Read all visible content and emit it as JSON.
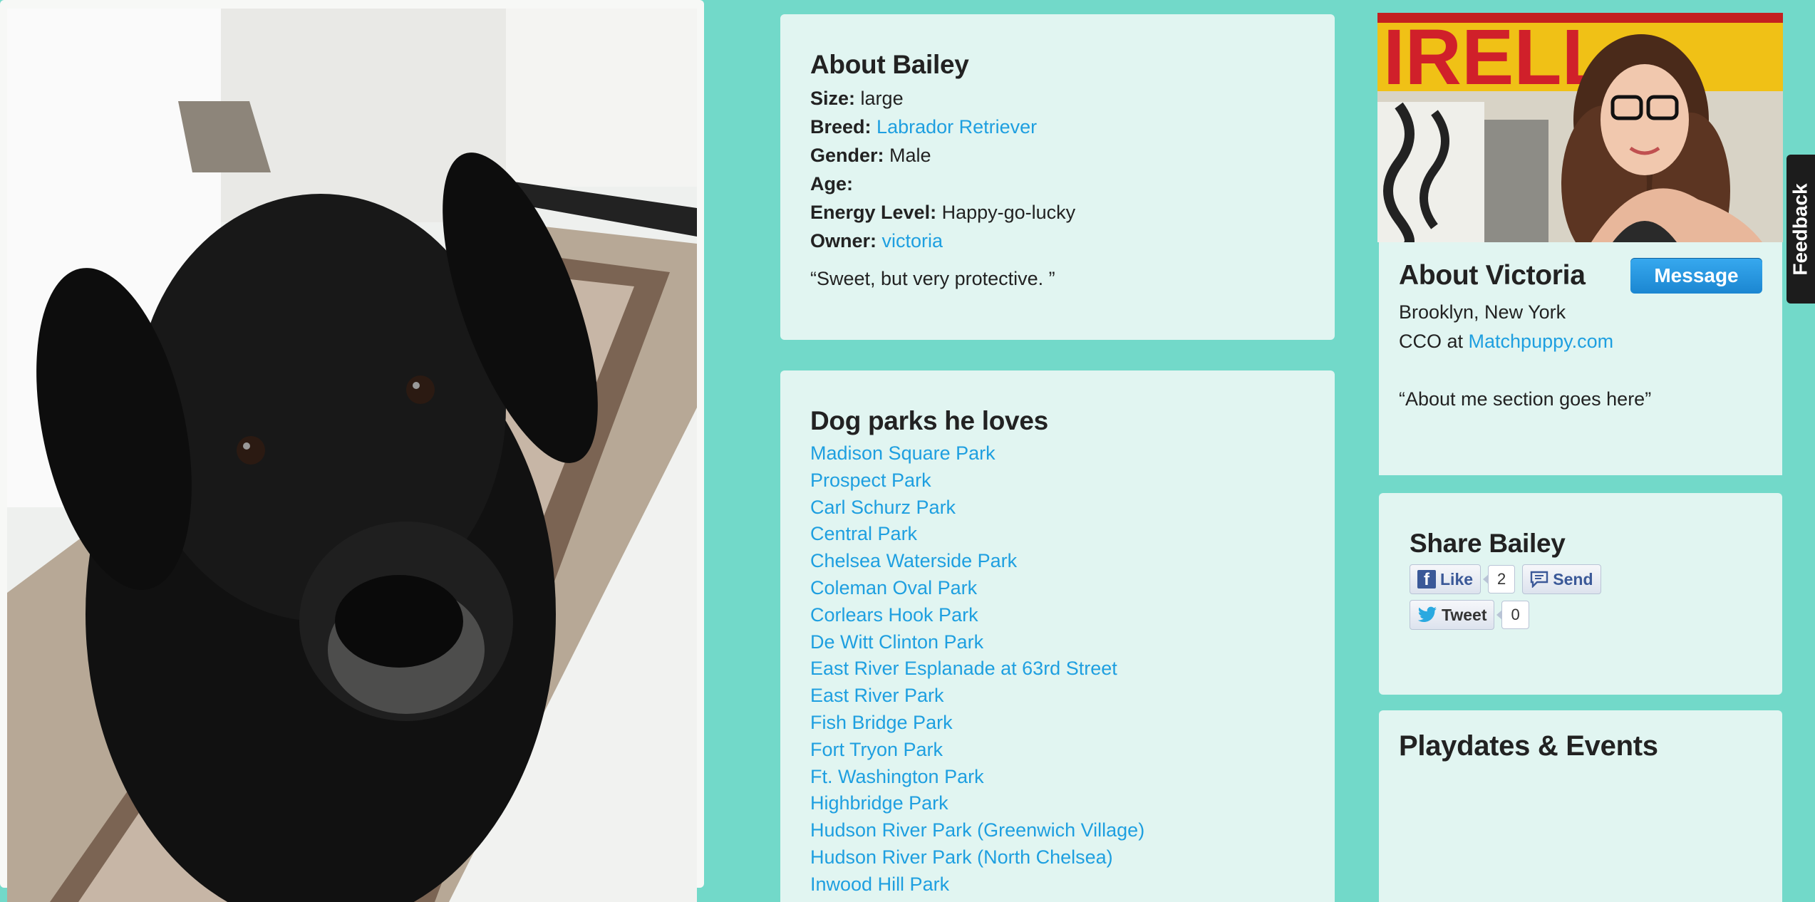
{
  "dog": {
    "heading": "About Bailey",
    "facts": [
      {
        "label": "Size:",
        "value": "large",
        "link": false
      },
      {
        "label": "Breed:",
        "value": "Labrador Retriever",
        "link": true
      },
      {
        "label": "Gender:",
        "value": "Male",
        "link": false
      },
      {
        "label": "Age:",
        "value": "",
        "link": false
      },
      {
        "label": "Energy Level:",
        "value": "Happy-go-lucky",
        "link": false
      },
      {
        "label": "Owner:",
        "value": "victoria",
        "link": true
      }
    ],
    "quote": "“Sweet, but very protective. ”"
  },
  "parks": {
    "heading": "Dog parks he loves",
    "items": [
      "Madison Square Park",
      "Prospect Park",
      "Carl Schurz Park",
      "Central Park",
      "Chelsea Waterside Park",
      "Coleman Oval Park",
      "Corlears Hook Park",
      "De Witt Clinton Park",
      "East River Esplanade at 63rd Street",
      "East River Park",
      "Fish Bridge Park",
      "Fort Tryon Park",
      "Ft. Washington Park",
      "Highbridge Park",
      "Hudson River Park (Greenwich Village)",
      "Hudson River Park (North Chelsea)",
      "Inwood Hill Park"
    ]
  },
  "owner": {
    "heading": "About Victoria",
    "message_label": "Message",
    "location": "Brooklyn, New York",
    "job_prefix": "CCO at ",
    "company": "Matchpuppy.com",
    "about": "“About me section goes here”",
    "photo_sign_text": "IRELL"
  },
  "share": {
    "heading": "Share Bailey",
    "like_label": "Like",
    "like_count": "2",
    "send_label": "Send",
    "tweet_label": "Tweet",
    "tweet_count": "0"
  },
  "events": {
    "heading": "Playdates & Events"
  },
  "feedback_label": "Feedback",
  "colors": {
    "background": "#72d9c9",
    "panel": "#e1f5f1",
    "link": "#1e9fe0",
    "button": "#2396dc"
  }
}
